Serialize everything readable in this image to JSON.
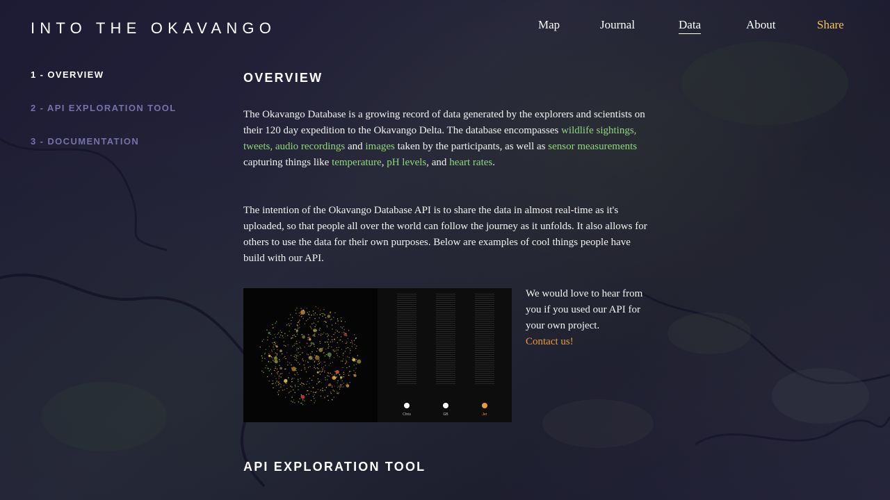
{
  "header": {
    "logo": "INTO THE OKAVANGO",
    "nav": [
      {
        "label": "Map",
        "active": false
      },
      {
        "label": "Journal",
        "active": false
      },
      {
        "label": "Data",
        "active": true
      },
      {
        "label": "About",
        "active": false
      },
      {
        "label": "Share",
        "active": false
      }
    ]
  },
  "sidebar": {
    "items": [
      {
        "label": "1 - OVERVIEW",
        "active": true
      },
      {
        "label": "2 - API EXPLORATION TOOL",
        "active": false
      },
      {
        "label": "3 - DOCUMENTATION",
        "active": false
      }
    ]
  },
  "overview": {
    "title": "OVERVIEW",
    "p1": {
      "t1": "The Okavango Database is a growing record of data generated by the explorers and scientists on their 120 day expedition to the Okavango Delta. The database encompasses ",
      "l1": "wildlife sightings, tweets, audio recordings",
      "t2": " and ",
      "l2": "images",
      "t3": " taken by the participants, as well as ",
      "l3": "sensor measurements",
      "t4": " capturing things like ",
      "l4": "temperature",
      "t5": ", ",
      "l5": "pH levels",
      "t6": ", and ",
      "l6": "heart rates",
      "t7": "."
    },
    "p2": "The intention of the Okavango Database API is to share the data in almost real-time as it's uploaded, so that people all over the world can follow the journey as it unfolds. It also allows for others to use the data for their own purposes. Below are examples of cool things people have build with our API.",
    "showcase_labels": [
      "Chris",
      "GB",
      "Jer"
    ],
    "contact_text": "We would love to hear from you if you used our API for your own project.",
    "contact_link": "Contact us!"
  },
  "api_section": {
    "title": "API EXPLORATION TOOL"
  },
  "colors": {
    "link_green": "#8ed87a",
    "share_yellow": "#f0c75e",
    "contact_orange": "#e89a3c",
    "sidebar_inactive": "#7672a8"
  }
}
